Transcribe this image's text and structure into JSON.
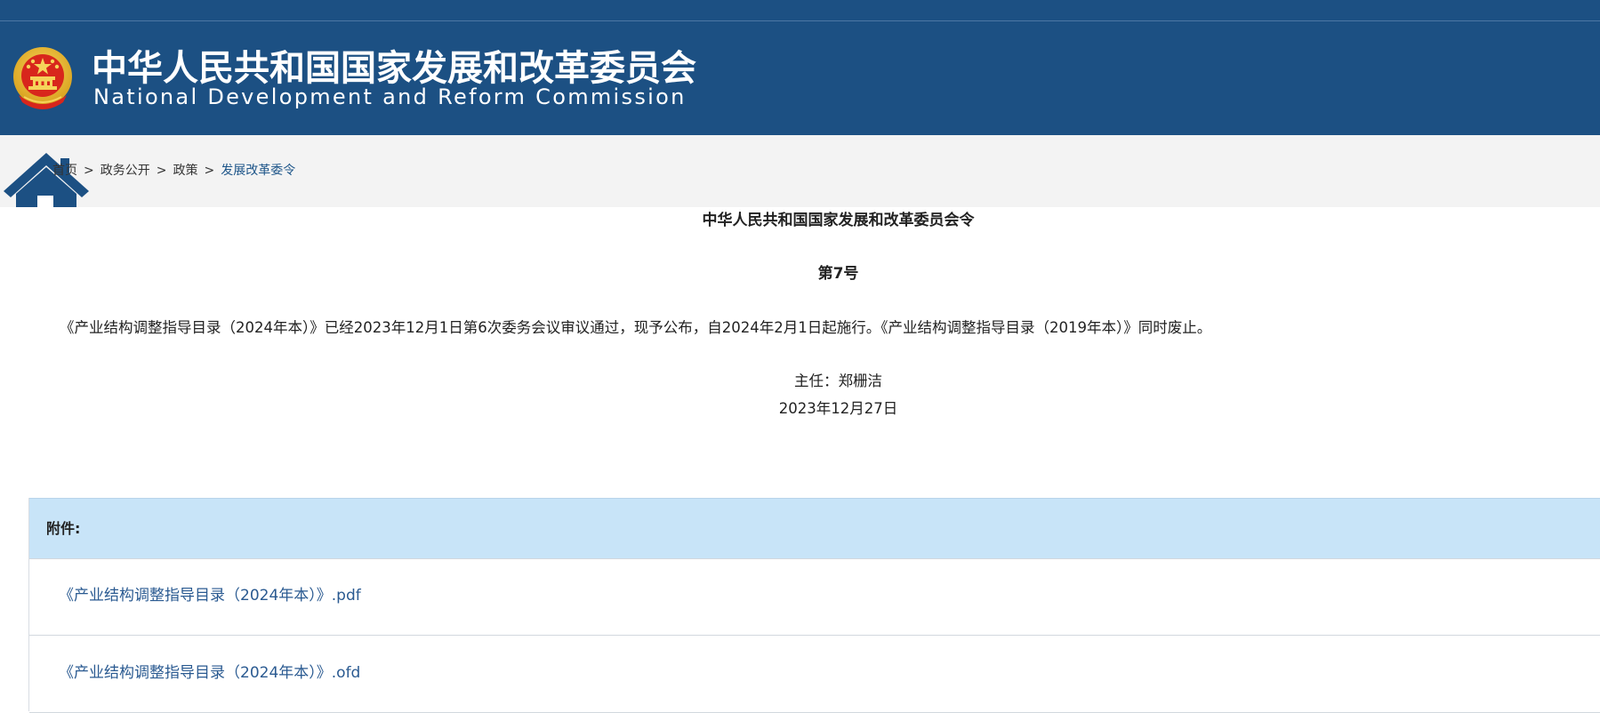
{
  "header": {
    "title_cn": "中华人民共和国国家发展和改革委员会",
    "title_en": "National Development and Reform Commission",
    "logo": "national-emblem-icon",
    "colors": {
      "banner": "#1c5083",
      "crumb_bg": "#f3f3f3",
      "link": "#2a5a91",
      "attach_bg": "#c8e4f8"
    }
  },
  "breadcrumb": {
    "icon": "home-icon",
    "items": [
      "首页",
      "政务公开",
      "政策",
      "发展改革委令"
    ],
    "separator": ">"
  },
  "article": {
    "title": "中华人民共和国国家发展和改革委员会令",
    "number": "第7号",
    "body": "《产业结构调整指导目录（2024年本）》已经2023年12月1日第6次委务会议审议通过，现予公布，自2024年2月1日起施行。《产业结构调整指导目录（2019年本）》同时废止。",
    "signature": "主任：郑栅洁",
    "date": "2023年12月27日"
  },
  "attachments": {
    "label": "附件:",
    "files": [
      "《产业结构调整指导目录（2024年本）》.pdf",
      "《产业结构调整指导目录（2024年本）》.ofd"
    ]
  }
}
